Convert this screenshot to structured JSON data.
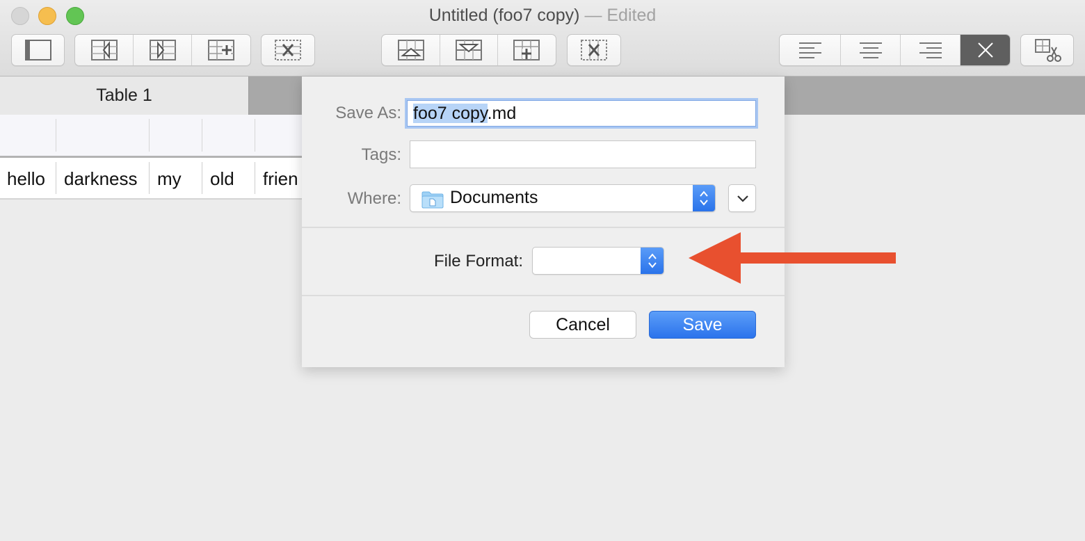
{
  "window": {
    "title": "Untitled (foo7 copy)",
    "edited_suffix": "— Edited"
  },
  "toolbar": {
    "groups": [
      {
        "name": "sidebar",
        "buttons": [
          "sidebar-toggle-icon"
        ]
      },
      {
        "name": "columns",
        "buttons": [
          "insert-column-left-icon",
          "insert-column-right-icon",
          "add-column-icon"
        ]
      },
      {
        "name": "delete-column",
        "buttons": [
          "delete-column-icon"
        ]
      },
      {
        "name": "rows",
        "buttons": [
          "insert-row-above-icon",
          "insert-row-below-icon",
          "add-row-icon"
        ]
      },
      {
        "name": "delete-row",
        "buttons": [
          "delete-row-icon"
        ]
      },
      {
        "name": "alignment",
        "buttons": [
          "align-left-icon",
          "align-center-icon",
          "align-right-icon",
          "close-icon"
        ]
      },
      {
        "name": "cut",
        "buttons": [
          "cut-cells-icon"
        ]
      }
    ]
  },
  "tabs": [
    {
      "label": "Table 1",
      "active": true
    }
  ],
  "table": {
    "row": [
      "hello",
      "darkness",
      "my",
      "old",
      "frien"
    ]
  },
  "save_dialog": {
    "save_as_label": "Save As:",
    "filename_selected": "foo7 copy",
    "filename_extension": ".md",
    "tags_label": "Tags:",
    "tags_value": "",
    "where_label": "Where:",
    "where_value": "Documents",
    "where_icon": "folder-icon",
    "file_format_label": "File Format:",
    "file_format_value": "",
    "cancel_label": "Cancel",
    "save_label": "Save",
    "accent_color": "#2b73ec"
  },
  "annotation": {
    "type": "arrow",
    "color": "#e8502f",
    "points_to": "file-format-popup"
  }
}
